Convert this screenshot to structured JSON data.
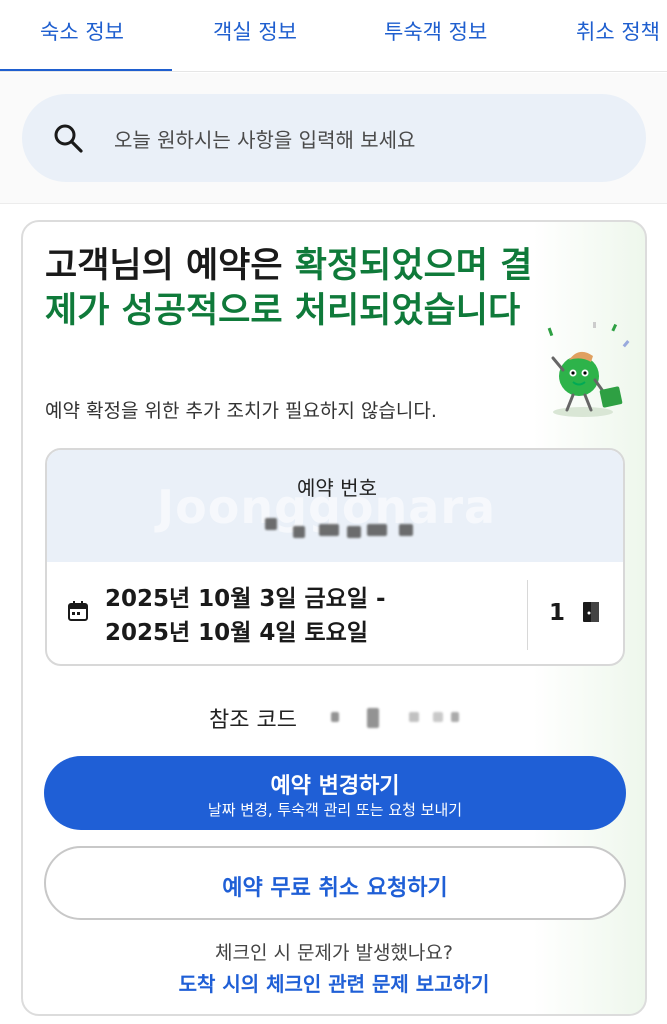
{
  "tabs": [
    {
      "label": "숙소 정보",
      "active": true
    },
    {
      "label": "객실 정보"
    },
    {
      "label": "투숙객 정보"
    },
    {
      "label": "취소 정책"
    }
  ],
  "search": {
    "placeholder": "오늘 원하시는 사항을 입력해 보세요"
  },
  "confirmation": {
    "headline_part1": "고객님의 예약은 ",
    "headline_part2": "확정되었으며 결제가 성공적으로 처리되었습니다",
    "subtext": "예약 확정을 위한 추가 조치가 필요하지 않습니다."
  },
  "reservation": {
    "number_label": "예약 번호",
    "date_line1": "2025년 10월 3일 금요일 -",
    "date_line2": "2025년 10월 4일 토요일",
    "room_count": "1"
  },
  "reference": {
    "label": "참조 코드"
  },
  "buttons": {
    "modify_title": "예약 변경하기",
    "modify_sub": "날짜 변경, 투숙객 관리 또는 요청 보내기",
    "cancel": "예약 무료 취소 요청하기"
  },
  "help": {
    "question": "체크인 시 문제가 발생했나요?",
    "link": "도착 시의 체크인 관련 문제 보고하기"
  },
  "watermark": "Joonggonara",
  "colors": {
    "accent": "#1f5fd6",
    "success": "#0f7a3a"
  },
  "icons": [
    "search-icon",
    "calendar-icon",
    "door-icon",
    "mascot-illustration"
  ]
}
